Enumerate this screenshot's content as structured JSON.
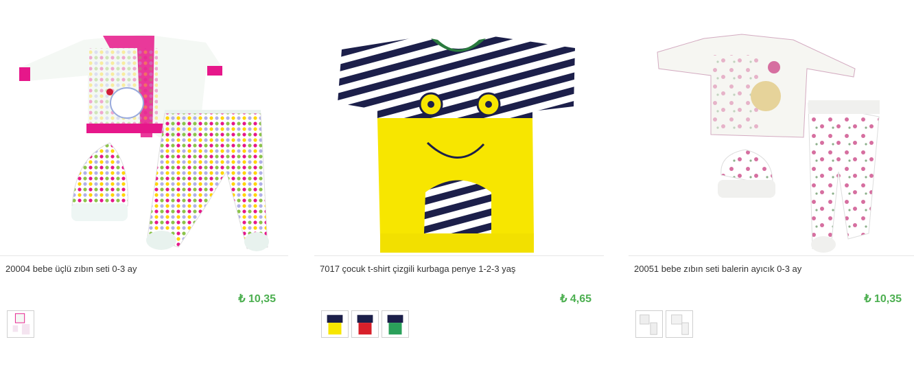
{
  "currency_symbol": "₺",
  "products": [
    {
      "name": "20004 bebe üçlü zıbın seti 0-3 ay",
      "price": "₺ 10,35",
      "thumb_count": 1
    },
    {
      "name": "7017 çocuk t-shirt çizgili kurbaga penye 1-2-3 yaş",
      "price": "₺ 4,65",
      "thumb_count": 3,
      "thumb_colors": [
        "yellow",
        "red",
        "green"
      ]
    },
    {
      "name": "20051 bebe zıbın seti balerin ayıcık 0-3 ay",
      "price": "₺ 10,35",
      "thumb_count": 2
    }
  ],
  "colors": {
    "price": "#4caf50",
    "text": "#333333",
    "divider": "#e6e6e6",
    "shirt_yellow": "#f7e600",
    "stripe_navy": "#1c1f4a",
    "accent_pink": "#e6178a"
  }
}
